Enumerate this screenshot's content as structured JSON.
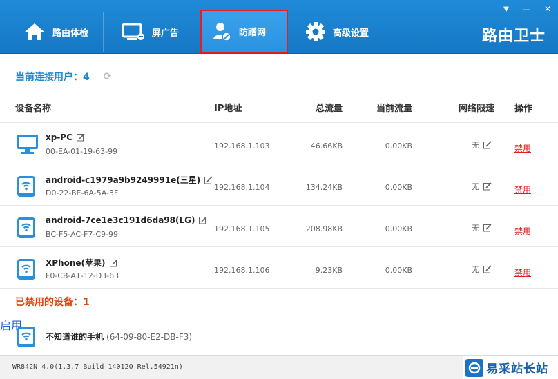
{
  "header": {
    "tabs": [
      {
        "label": "路由体检",
        "icon": "home-icon",
        "active": false
      },
      {
        "label": "屏广告",
        "icon": "monitor-icon",
        "active": false
      },
      {
        "label": "防蹭网",
        "icon": "user-shield-icon",
        "active": true
      },
      {
        "label": "高级设置",
        "icon": "gear-icon",
        "active": false
      }
    ],
    "logo": "路由卫士",
    "window_controls": {
      "menu": "▼",
      "minimize": "—",
      "close": "✕"
    }
  },
  "online": {
    "title": "当前连接用户：4",
    "columns": {
      "name": "设备名称",
      "ip": "IP地址",
      "total": "总流量",
      "current": "当前流量",
      "limit": "网络限速",
      "action": "操作"
    },
    "devices": [
      {
        "name": "xp-PC",
        "mac": "00-EA-01-19-63-99",
        "ip": "192.168.1.103",
        "total": "46.66KB",
        "current": "0.00KB",
        "limit": "无",
        "action": "禁用",
        "icon": "desktop-icon"
      },
      {
        "name": "android-c1979a9b9249991e(三星)",
        "mac": "D0-22-BE-6A-5A-3F",
        "ip": "192.168.1.104",
        "total": "134.24KB",
        "current": "0.00KB",
        "limit": "无",
        "action": "禁用",
        "icon": "wifi-device-icon"
      },
      {
        "name": "android-7ce1e3c191d6da98(LG)",
        "mac": "BC-F5-AC-F7-C9-99",
        "ip": "192.168.1.105",
        "total": "208.98KB",
        "current": "0.00KB",
        "limit": "无",
        "action": "禁用",
        "icon": "wifi-device-icon"
      },
      {
        "name": "XPhone(苹果)",
        "mac": "F0-CB-A1-12-D3-63",
        "ip": "192.168.1.106",
        "total": "9.23KB",
        "current": "0.00KB",
        "limit": "无",
        "action": "禁用",
        "icon": "wifi-device-icon"
      }
    ]
  },
  "banned": {
    "title": "已禁用的设备：1",
    "devices": [
      {
        "name": "不知道谁的手机",
        "mac": "(64-09-80-E2-DB-F3)",
        "action": "启用",
        "icon": "wifi-device-icon"
      }
    ]
  },
  "status": {
    "version": "WR842N 4.0(1.3.7 Build 140120 Rel.54921n)",
    "watermark": "易采站长站"
  },
  "colors": {
    "header_blue": "#1677c4",
    "accent_blue": "#1e88d4",
    "banned_orange": "#d9480f",
    "ban_red": "#e02020",
    "enable_blue": "#1a5fcf",
    "highlight_red": "#e51f1f"
  }
}
